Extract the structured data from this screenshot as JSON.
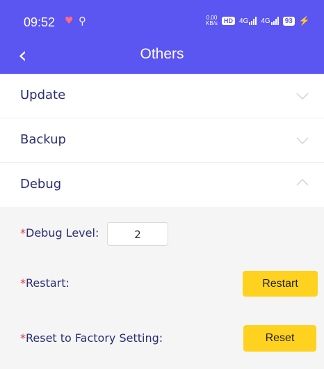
{
  "status_bar": {
    "time": "09:52",
    "net_speed_value": "0.00",
    "net_speed_unit": "KB/s",
    "hd_badge": "HD",
    "signal1_label": "4G",
    "signal2_label": "4G",
    "battery": "93",
    "icons": [
      "heart-icon",
      "usb-icon",
      "hd-icon",
      "signal-icon",
      "signal-icon",
      "battery-icon",
      "charging-icon"
    ]
  },
  "header": {
    "title": "Others",
    "back_icon": "chevron-left-icon"
  },
  "sections": [
    {
      "label": "Update",
      "expanded": false
    },
    {
      "label": "Backup",
      "expanded": false
    },
    {
      "label": "Debug",
      "expanded": true
    }
  ],
  "debug": {
    "debug_level_label": "Debug Level:",
    "debug_level_value": "2",
    "restart_label": "Restart:",
    "restart_button": "Restart",
    "reset_label": "Reset to Factory Setting:",
    "reset_button": "Reset",
    "required_marker": "*"
  },
  "colors": {
    "header_bg": "#5b55f2",
    "button_bg": "#ffd21f",
    "required": "#e43c3c",
    "label_text": "#2b2e73",
    "panel_bg": "#f5f5f5"
  }
}
